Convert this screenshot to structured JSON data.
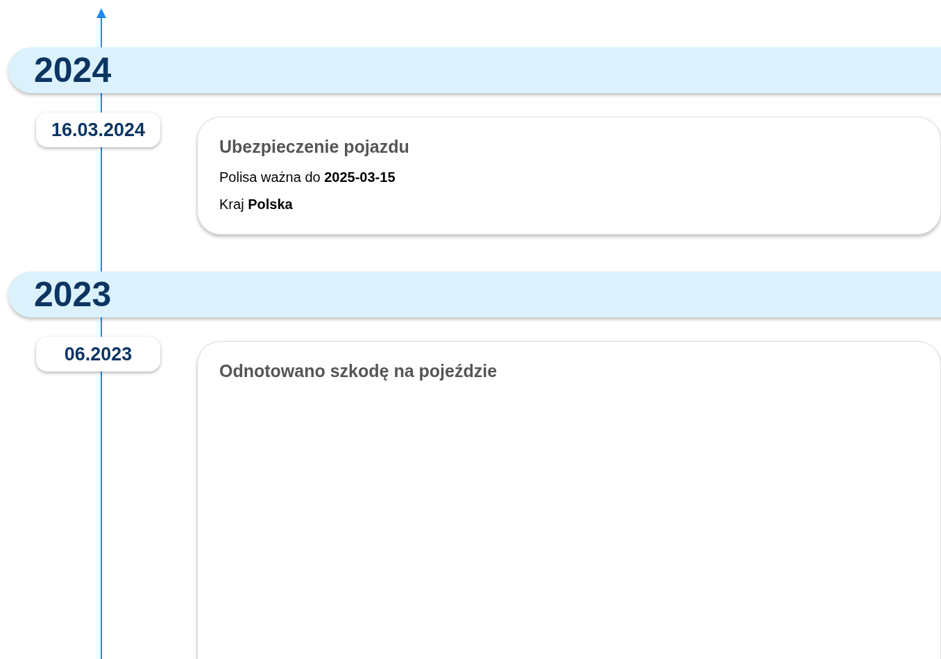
{
  "timeline": [
    {
      "year": "2024",
      "events": [
        {
          "date": "16.03.2024",
          "title": "Ubezpieczenie pojazdu",
          "details": [
            "Polisa ważna do **2025-03-15**",
            "Kraj **Polska**"
          ]
        }
      ]
    },
    {
      "year": "2023",
      "events": [
        {
          "date": "06.2023",
          "title": "Odnotowano szkodę na pojeździe"
        }
      ]
    }
  ]
}
